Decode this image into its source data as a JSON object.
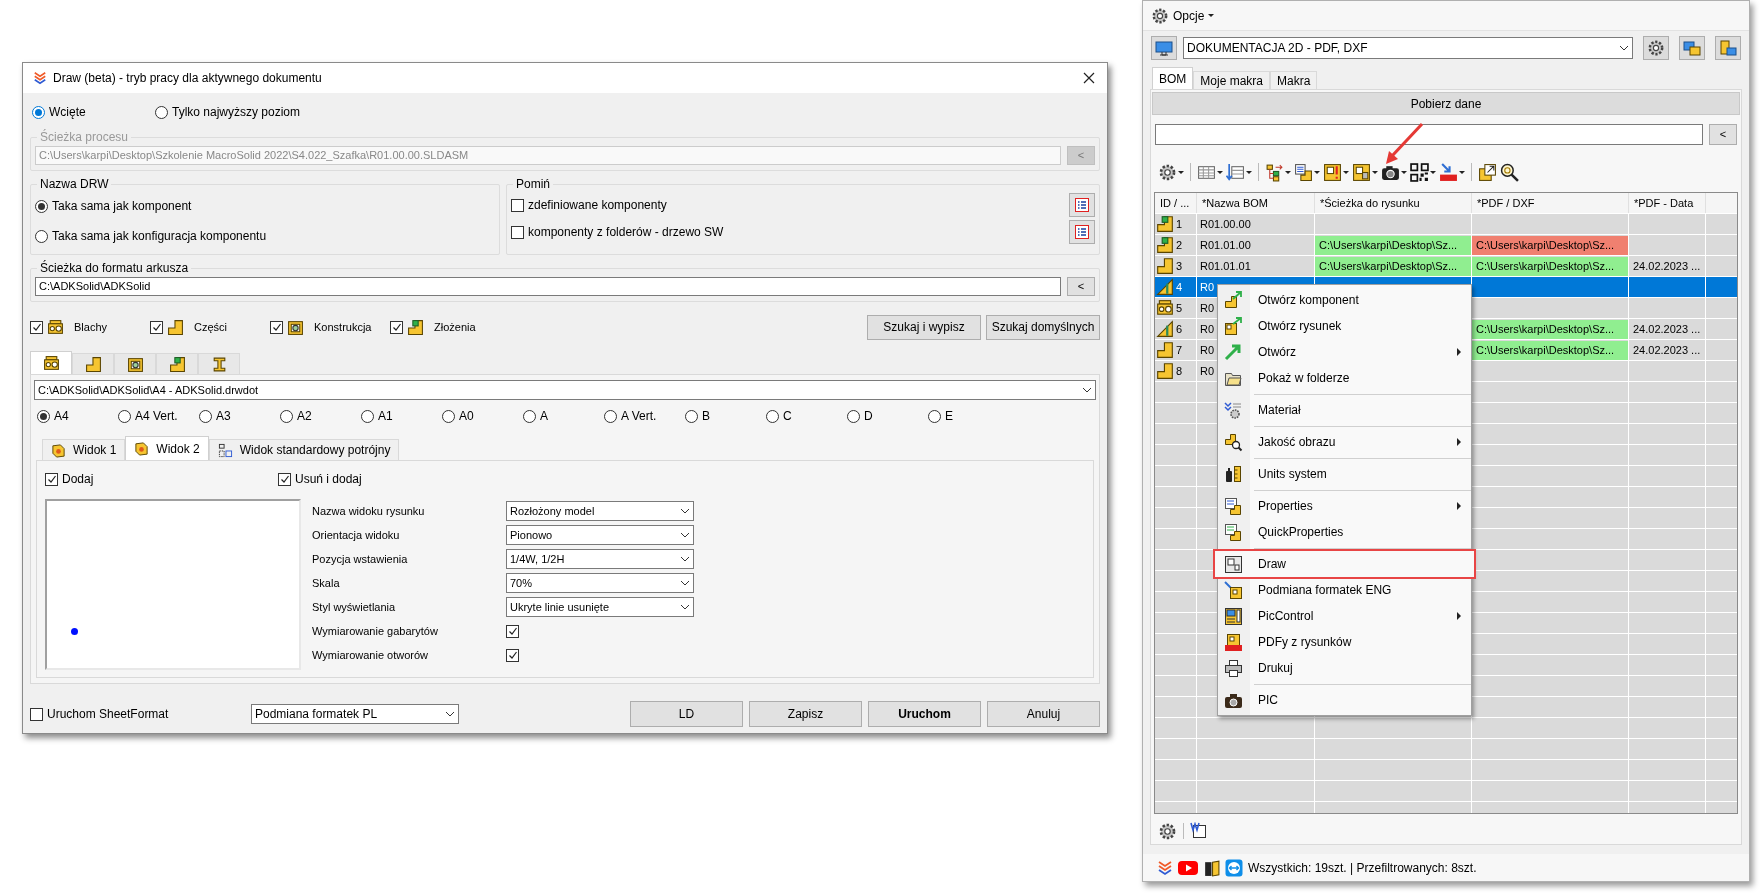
{
  "dialog": {
    "title": "Draw (beta) - tryb pracy dla aktywnego dokumentu",
    "mode_options": [
      {
        "label": "Wcięte",
        "selected": true
      },
      {
        "label": "Tylko najwyższy poziom",
        "selected": false
      }
    ],
    "process_path": {
      "label": "Ścieżka procesu",
      "value": "C:\\Users\\karpi\\Desktop\\Szkolenie MacroSolid 2022\\S4.022_Szafka\\R01.00.00.SLDASM",
      "disabled": true,
      "button": "<"
    },
    "drw_name": {
      "label": "Nazwa DRW",
      "options": [
        {
          "label": "Taka sama jak komponent",
          "selected": true
        },
        {
          "label": "Taka sama jak konfiguracja komponentu",
          "selected": false
        }
      ]
    },
    "skip": {
      "label": "Pomiń",
      "options": [
        {
          "label": "zdefiniowane komponenty",
          "checked": false
        },
        {
          "label": "komponenty z folderów - drzewo SW",
          "checked": false
        }
      ]
    },
    "sheet_format_path": {
      "label": "Ścieżka do formatu arkusza",
      "value": "C:\\ADKSolid\\ADKSolid",
      "button": "<"
    },
    "component_types": [
      {
        "label": "Blachy",
        "kind": "sheetmetal",
        "checked": true
      },
      {
        "label": "Części",
        "kind": "part",
        "checked": true
      },
      {
        "label": "Konstrukcja",
        "kind": "weldment",
        "checked": true
      },
      {
        "label": "Złożenia",
        "kind": "assembly",
        "checked": true
      }
    ],
    "search_buttons": [
      "Szukaj i wypisz",
      "Szukaj domyślnych"
    ],
    "type_tabs": [
      {
        "kind": "sheetmetal",
        "selected": true
      },
      {
        "kind": "part",
        "selected": false
      },
      {
        "kind": "weldment",
        "selected": false
      },
      {
        "kind": "assembly",
        "selected": false
      },
      {
        "kind": "beam",
        "selected": false
      }
    ],
    "template": {
      "value": "C:\\ADKSolid\\ADKSolid\\A4 - ADKSolid.drwdot"
    },
    "sheet_sizes": [
      {
        "label": "A4",
        "selected": true
      },
      {
        "label": "A4 Vert.",
        "selected": false
      },
      {
        "label": "A3",
        "selected": false
      },
      {
        "label": "A2",
        "selected": false
      },
      {
        "label": "A1",
        "selected": false
      },
      {
        "label": "A0",
        "selected": false
      },
      {
        "label": "A",
        "selected": false
      },
      {
        "label": "A Vert.",
        "selected": false
      },
      {
        "label": "B",
        "selected": false
      },
      {
        "label": "C",
        "selected": false
      },
      {
        "label": "D",
        "selected": false
      },
      {
        "label": "E",
        "selected": false
      }
    ],
    "view_tabs": [
      {
        "label": "Widok 1",
        "kind": "view",
        "selected": false
      },
      {
        "label": "Widok 2",
        "kind": "view",
        "selected": true
      },
      {
        "label": "Widok standardowy potrójny",
        "kind": "triple",
        "selected": false
      }
    ],
    "view_panel": {
      "add": {
        "label": "Dodaj",
        "checked": true
      },
      "remove_and_add": {
        "label": "Usuń i dodaj",
        "checked": true
      },
      "properties": [
        {
          "label": "Nazwa widoku rysunku",
          "kind": "select",
          "value": "Rozłożony model"
        },
        {
          "label": "Orientacja widoku",
          "kind": "select",
          "value": "Pionowo"
        },
        {
          "label": "Pozycja wstawienia",
          "kind": "select",
          "value": "1/4W, 1/2H"
        },
        {
          "label": "Skala",
          "kind": "select",
          "value": "70%"
        },
        {
          "label": "Styl wyświetlania",
          "kind": "select",
          "value": "Ukryte linie usunięte"
        },
        {
          "label": "Wymiarowanie gabarytów",
          "kind": "checkbox",
          "checked": true
        },
        {
          "label": "Wymiarowanie otworów",
          "kind": "checkbox",
          "checked": true
        }
      ]
    },
    "sheetformat_run": {
      "label": "Uruchom SheetFormat",
      "checked": false
    },
    "format_select": {
      "value": "Podmiana formatek PL"
    },
    "buttons": [
      {
        "label": "LD",
        "default": false
      },
      {
        "label": "Zapisz",
        "default": false
      },
      {
        "label": "Uruchom",
        "default": true
      },
      {
        "label": "Anuluj",
        "default": false
      }
    ]
  },
  "panel": {
    "menu_label": "Opcje",
    "profile": {
      "value": "DOKUMENTACJA 2D - PDF, DXF"
    },
    "tabs": [
      {
        "label": "BOM",
        "selected": true
      },
      {
        "label": "Moje makra",
        "selected": false
      },
      {
        "label": "Makra",
        "selected": false
      }
    ],
    "fetch_button": "Pobierz dane",
    "filter_button": "<",
    "table": {
      "columns": [
        "ID / ...",
        "*Nazwa BOM",
        "*Ścieżka do rysunku",
        "*PDF / DXF",
        "*PDF - Data"
      ],
      "rows": [
        {
          "id": "1",
          "kind": "assembly",
          "name": "R01.00.00",
          "selected": false
        },
        {
          "id": "2",
          "kind": "assembly",
          "name": "R01.01.00",
          "selected": false,
          "drawing_path": {
            "text": "C:\\Users\\karpi\\Desktop\\Sz...",
            "color": "#90ee90"
          },
          "pdf": {
            "text": "C:\\Users\\karpi\\Desktop\\Sz...",
            "color": "#f08070"
          }
        },
        {
          "id": "3",
          "kind": "part",
          "name": "R01.01.01",
          "selected": false,
          "drawing_path": {
            "text": "C:\\Users\\karpi\\Desktop\\Sz...",
            "color": "#90ee90"
          },
          "pdf": {
            "text": "C:\\Users\\karpi\\Desktop\\Sz...",
            "color": "#90ee90"
          },
          "pdf_date": "24.02.2023 ..."
        },
        {
          "id": "4",
          "kind": "gusset",
          "name": "R0",
          "selected": true
        },
        {
          "id": "5",
          "kind": "sheetmetal",
          "name": "R0",
          "selected": false
        },
        {
          "id": "6",
          "kind": "gusset",
          "name": "R0",
          "selected": false,
          "pdf": {
            "text": "C:\\Users\\karpi\\Desktop\\Sz...",
            "color": "#90ee90"
          },
          "pdf_date": "24.02.2023 ..."
        },
        {
          "id": "7",
          "kind": "part",
          "name": "R0",
          "selected": false,
          "pdf": {
            "text": "C:\\Users\\karpi\\Desktop\\Sz...",
            "color": "#90ee90"
          },
          "pdf_date": "24.02.2023 ..."
        },
        {
          "id": "8",
          "kind": "part",
          "name": "R0",
          "selected": false
        }
      ]
    },
    "status_text": "Wszystkich: 19szt. | Przefiltrowanych: 8szt."
  },
  "context_menu": {
    "items": [
      {
        "kind": "item",
        "label": "Otwórz komponent",
        "submenu": false,
        "highlighted": false
      },
      {
        "kind": "item",
        "label": "Otwórz rysunek",
        "submenu": false,
        "highlighted": false
      },
      {
        "kind": "item",
        "label": "Otwórz",
        "submenu": true,
        "highlighted": false
      },
      {
        "kind": "item",
        "label": "Pokaż w folderze",
        "submenu": false,
        "highlighted": false
      },
      {
        "kind": "separator"
      },
      {
        "kind": "item",
        "label": "Materiał",
        "submenu": false,
        "highlighted": false
      },
      {
        "kind": "separator"
      },
      {
        "kind": "item",
        "label": "Jakość obrazu",
        "submenu": true,
        "highlighted": false
      },
      {
        "kind": "separator"
      },
      {
        "kind": "item",
        "label": "Units system",
        "submenu": false,
        "highlighted": false
      },
      {
        "kind": "separator"
      },
      {
        "kind": "item",
        "label": "Properties",
        "submenu": true,
        "highlighted": false
      },
      {
        "kind": "item",
        "label": "QuickProperties",
        "submenu": false,
        "highlighted": false
      },
      {
        "kind": "separator"
      },
      {
        "kind": "item",
        "label": "Draw",
        "submenu": false,
        "highlighted": true
      },
      {
        "kind": "item",
        "label": "Podmiana formatek ENG",
        "submenu": false,
        "highlighted": false
      },
      {
        "kind": "item",
        "label": "PicControl",
        "submenu": true,
        "highlighted": false
      },
      {
        "kind": "item",
        "label": "PDFy z rysunków",
        "submenu": false,
        "highlighted": false
      },
      {
        "kind": "item",
        "label": "Drukuj",
        "submenu": false,
        "highlighted": false
      },
      {
        "kind": "separator"
      },
      {
        "kind": "item",
        "label": "PIC",
        "submenu": false,
        "highlighted": false
      }
    ]
  }
}
